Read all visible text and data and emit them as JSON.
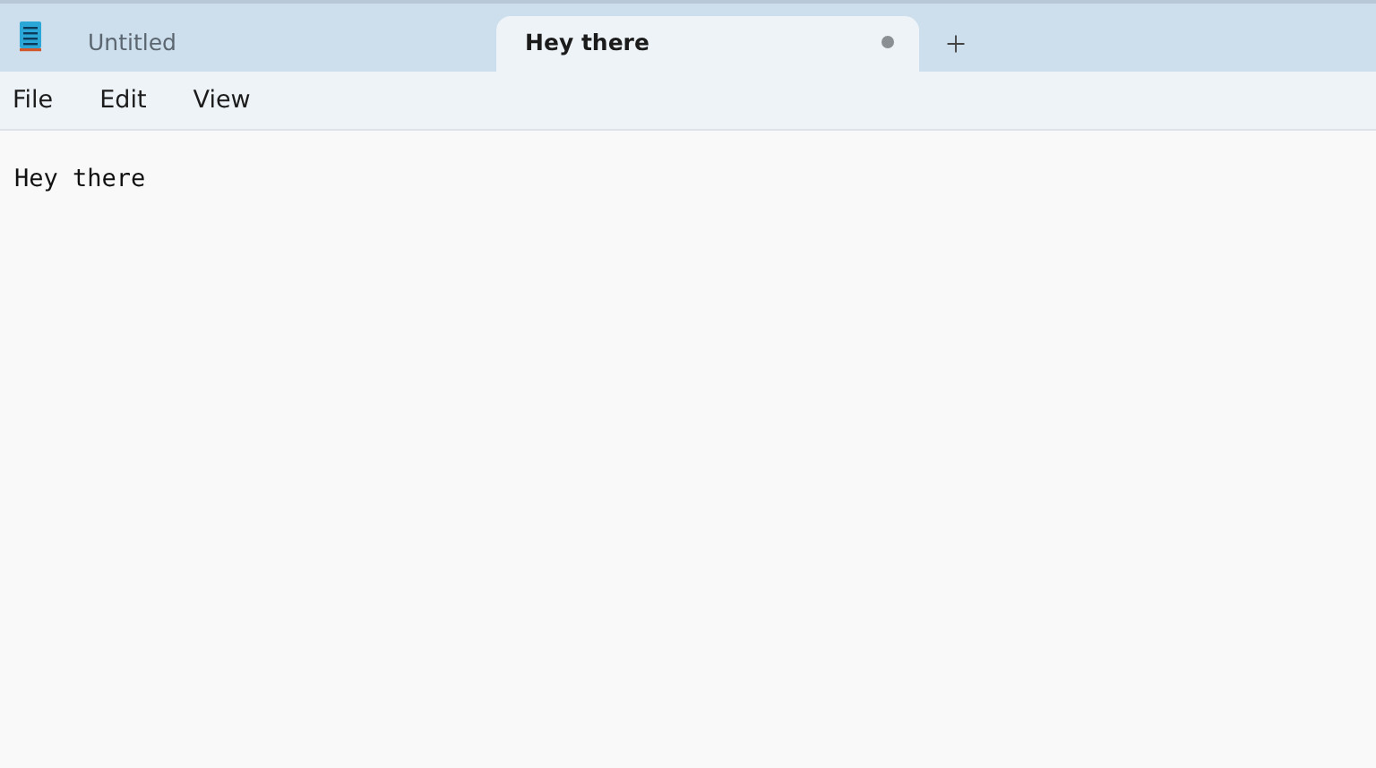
{
  "tabs": [
    {
      "title": "Untitled",
      "selected": false,
      "modified": false
    },
    {
      "title": "Hey there",
      "selected": true,
      "modified": true
    }
  ],
  "menu": [
    "File",
    "Edit",
    "View"
  ],
  "editor": {
    "text": "Hey there"
  }
}
